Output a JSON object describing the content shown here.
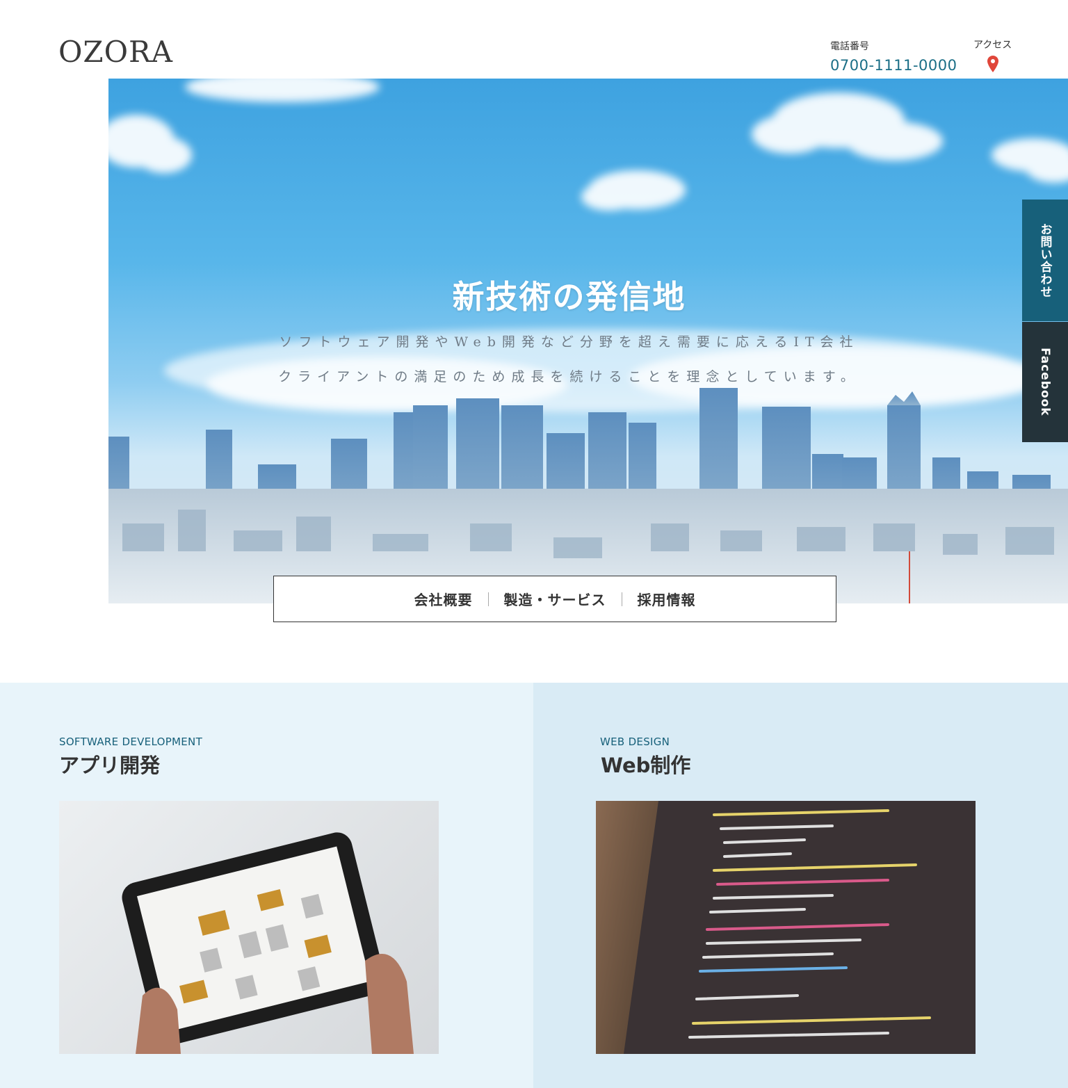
{
  "header": {
    "logo": "OZORA",
    "tel_label": "電話番号",
    "tel_number": "0700-1111-0000",
    "access_label": "アクセス",
    "access_icon": "map-pin-icon",
    "accent_color": "#1a6e86",
    "pin_color": "#e0463a"
  },
  "hero": {
    "title": "新技術の発信地",
    "subtitle_line1": "ソフトウェア開発やWeb開発など分野を超え需要に応えるIT会社",
    "subtitle_line2": "クライアントの満足のため成長を続けることを理念としています。"
  },
  "side_tabs": {
    "contact": "お問い合わせ",
    "facebook": "Facebook"
  },
  "nav": {
    "items": [
      "会社概要",
      "製造・サービス",
      "採用情報"
    ]
  },
  "services": [
    {
      "en": "SOFTWARE DEVELOPMENT",
      "jp": "アプリ開発"
    },
    {
      "en": "WEB DESIGN",
      "jp": "Web制作"
    }
  ]
}
